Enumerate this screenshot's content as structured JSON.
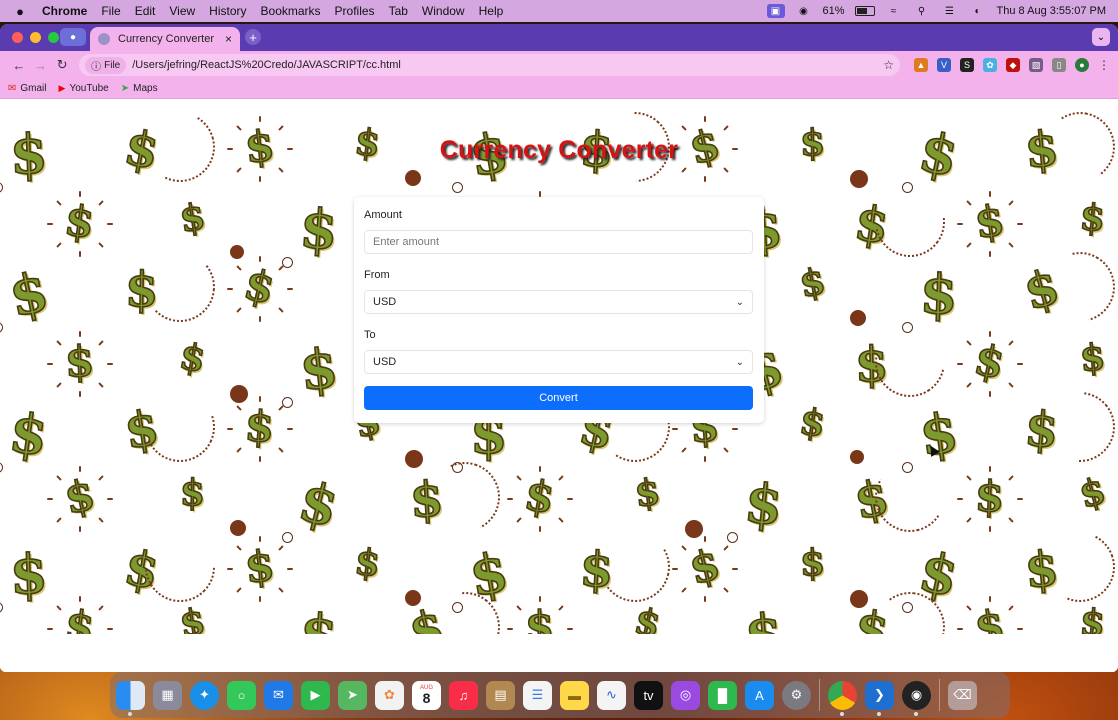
{
  "menubar": {
    "app_name": "Chrome",
    "menus": [
      "File",
      "Edit",
      "View",
      "History",
      "Bookmarks",
      "Profiles",
      "Tab",
      "Window",
      "Help"
    ],
    "battery": "61%",
    "datetime": "Thu 8 Aug  3:55:07 PM"
  },
  "browser": {
    "tab_title": "Currency Converter",
    "tab_close": "×",
    "new_tab": "+",
    "address_chip": "File",
    "address": "/Users/jefring/ReactJS%20Credo/JAVASCRIPT/cc.html",
    "bookmarks": [
      {
        "label": "Gmail",
        "icon": "gmail-icon"
      },
      {
        "label": "YouTube",
        "icon": "youtube-icon"
      },
      {
        "label": "Maps",
        "icon": "maps-icon"
      }
    ]
  },
  "page": {
    "title": "Currency Converter",
    "amount_label": "Amount",
    "amount_placeholder": "Enter amount",
    "from_label": "From",
    "from_value": "USD",
    "to_label": "To",
    "to_value": "USD",
    "convert_label": "Convert"
  },
  "dock": {
    "calendar_month": "AUG",
    "calendar_day": "8",
    "apps": [
      "finder-icon",
      "launchpad-icon",
      "safari-icon",
      "messages-icon",
      "mail-icon",
      "facetime-icon",
      "maps-app-icon",
      "photos-icon",
      "calendar-icon",
      "music-icon",
      "preview-icon",
      "reminders-icon",
      "notes-icon",
      "freeform-icon",
      "apple-tv-icon",
      "podcasts-icon",
      "numbers-icon",
      "app-store-icon",
      "system-settings-icon",
      "chrome-icon",
      "vscode-icon",
      "obs-icon",
      "trash-icon"
    ]
  },
  "colors": {
    "menubar": "#d4a7e0",
    "tabstrip": "#5a3bb0",
    "toolbar": "#f3b2ec",
    "title_red": "#d41414",
    "button_blue": "#0d6efd",
    "dollar_green": "#7c9a2e"
  }
}
